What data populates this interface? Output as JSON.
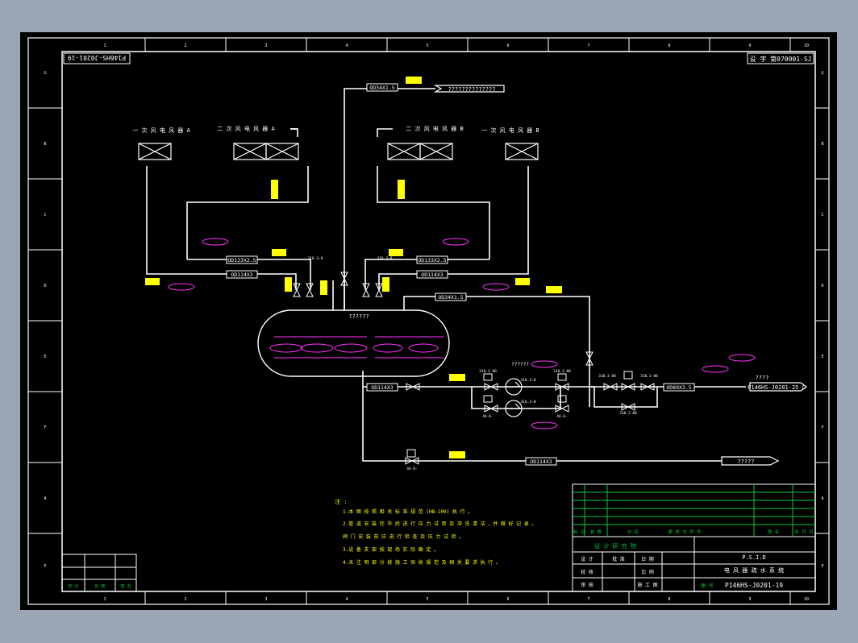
{
  "drawing": {
    "number_top_left": "P146HS-J0201-19",
    "number_top_right": "设 字 第070001-SJ",
    "col_labels": [
      "1",
      "2",
      "3",
      "4",
      "5",
      "6",
      "7",
      "8",
      "9",
      "10"
    ],
    "row_labels": [
      "G",
      "B",
      "C",
      "D",
      "E",
      "F",
      "A",
      "P"
    ]
  },
  "equipment": {
    "unit_1a": "一 次 风 电 风 器 A",
    "unit_2a": "二 次 风 电 风 器 A",
    "unit_2b": "二 次 风 电 风 器 B",
    "unit_1b": "一 次 风 电 风 器 B",
    "tank_label": "??????",
    "pump_label": "??????",
    "vent_label": "??????????????"
  },
  "pipes": {
    "vent_top": "OD34X1.5",
    "left_mid": "OD133X2.5",
    "right_mid": "OD133X2.5",
    "left_low": "OD114X3",
    "right_low": "OD114X3",
    "tank_right": "OD34X1.5",
    "pump_suction": "OD114X3",
    "discharge": "OD89X3.5",
    "drain": "OD114X3"
  },
  "destinations": {
    "to_other": "P146HS-J0201-25 C",
    "drain_out": "?????",
    "dest_note": "????"
  },
  "valve_tags": [
    "310.3 08",
    "44-6-",
    "316.3-0",
    "316.3 08"
  ],
  "notes": {
    "title": "注 :",
    "lines": [
      "1.本 图 按 照 相 关 标 准 规 范 (HB-100) 执 行 。",
      "2.管 道 安 装 完 毕 后 进 行 压 力 试 验 及 冲 洗 清 洁 ，并 做 好 记 录 。",
      "  阀 门 安 装 前 应 进 行 检 查 及 压 力 试 验 。",
      "3.设 备 支 架 按 现 场 实 际 确 定 。",
      "4.未 注 明 部 分 按 施 工 验 收 规 范 及 相 关 要 求 执 行 。"
    ]
  },
  "title_block": {
    "company": "设 计 研 究 院",
    "project": "P.S.I.D",
    "drawing_title": "电 风 器 疏 水 系 统",
    "drawing_no": "P146HS-J0201-19",
    "row_labels": [
      "设 计",
      "校 核",
      "审 核",
      "批 准"
    ],
    "cell_a": "日 期",
    "cell_b": "比 例",
    "cell_c": "图 号",
    "sign_stage": "施 工 图",
    "green_row": [
      "标 记",
      "处 数",
      "分 区",
      "更 改 文 件 号",
      "签 名",
      "年 月 日"
    ],
    "left_small": [
      "标 记",
      "处 数",
      "签 名"
    ]
  }
}
